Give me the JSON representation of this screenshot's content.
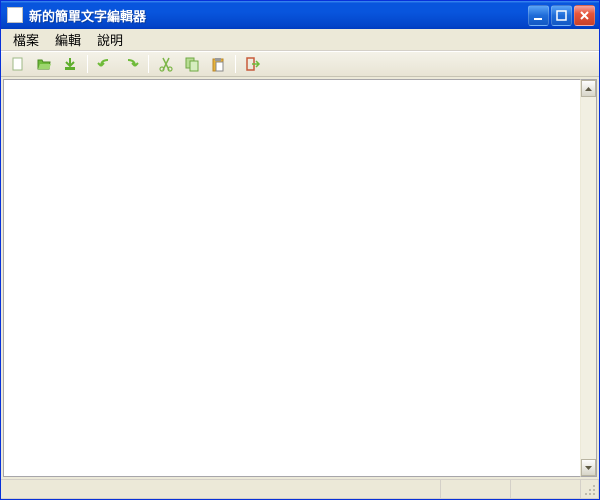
{
  "window": {
    "title": "新的簡單文字編輯器"
  },
  "menu": {
    "file": "檔案",
    "edit": "編輯",
    "help": "說明"
  },
  "toolbar": {
    "new": "new",
    "open": "open",
    "save": "save",
    "undo": "undo",
    "redo": "redo",
    "cut": "cut",
    "copy": "copy",
    "paste": "paste",
    "exit": "exit"
  },
  "icon_colors": {
    "primary": "#5fae2d",
    "accent": "#e8b33a"
  },
  "editor": {
    "content": ""
  },
  "statusbar": {
    "main": "",
    "cell1": "",
    "cell2": ""
  }
}
